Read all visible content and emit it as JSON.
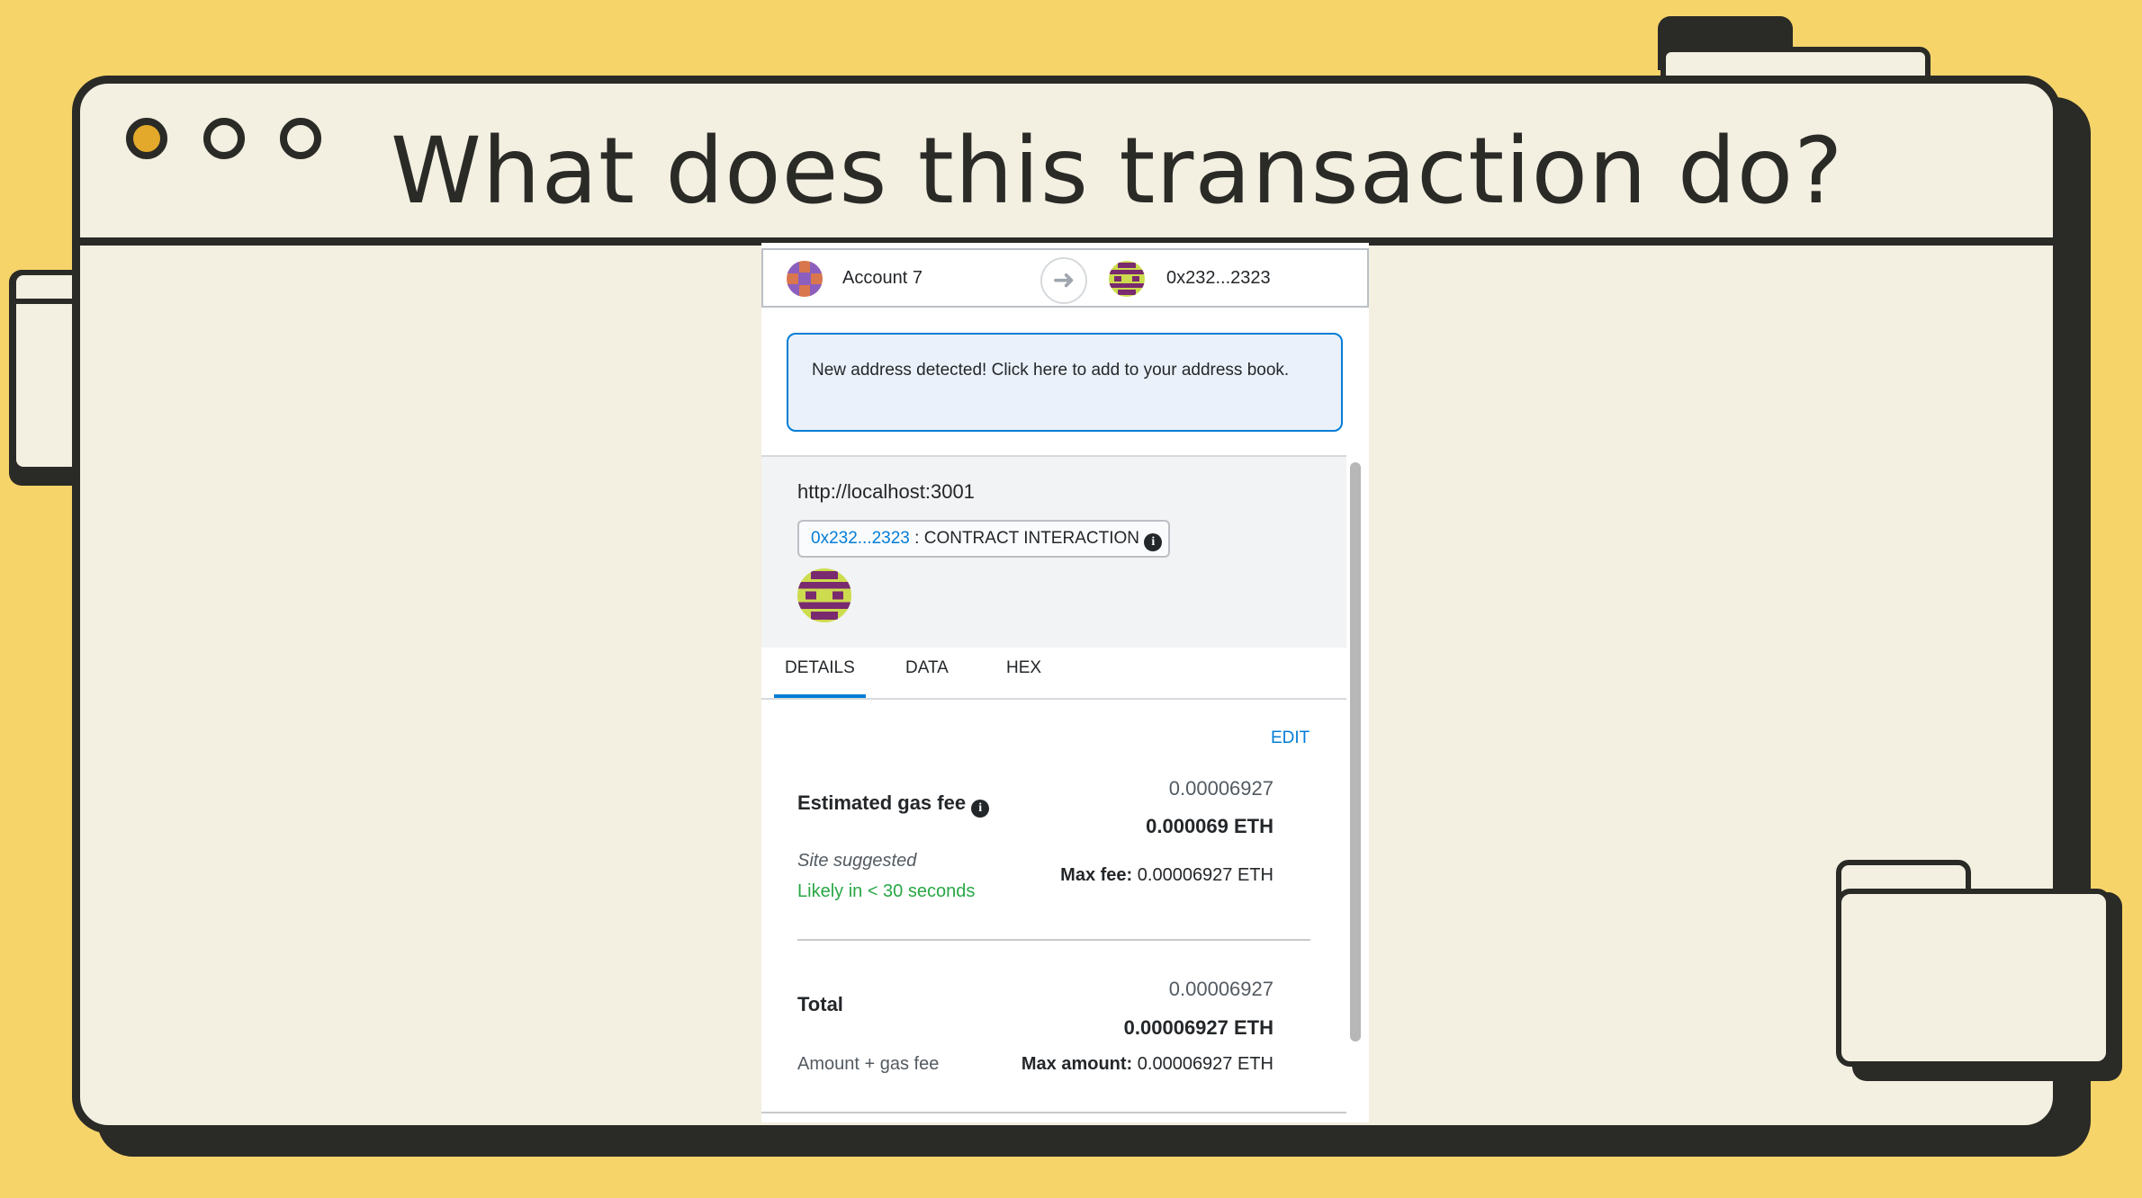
{
  "colors": {
    "background": "#f6d46a",
    "window": "#f3efe1",
    "ink": "#2a2a26",
    "accent_dot": "#e2a92b",
    "link": "#037dd6",
    "success": "#28a745"
  },
  "window": {
    "title": "What does this transaction do?"
  },
  "transaction": {
    "from_account": "Account 7",
    "to_address": "0x232...2323",
    "arrow_icon": "arrow-right",
    "banner": "New address detected! Click here to add to your address book.",
    "origin": "http://localhost:3001",
    "contract_link": "0x232...2323",
    "contract_separator": ":",
    "contract_type": "CONTRACT INTERACTION",
    "tabs": [
      "DETAILS",
      "DATA",
      "HEX"
    ],
    "active_tab": "DETAILS",
    "edit_label": "EDIT",
    "gas": {
      "label": "Estimated gas fee",
      "value": "0.00006927",
      "value_eth": "0.000069 ETH",
      "site_suggested": "Site suggested",
      "likely": "Likely in < 30 seconds",
      "max_fee_label": "Max fee:",
      "max_fee_value": "0.00006927 ETH"
    },
    "total": {
      "label": "Total",
      "value": "0.00006927",
      "value_eth": "0.00006927 ETH",
      "sublabel": "Amount + gas fee",
      "max_amount_label": "Max amount:",
      "max_amount_value": "0.00006927 ETH"
    }
  }
}
